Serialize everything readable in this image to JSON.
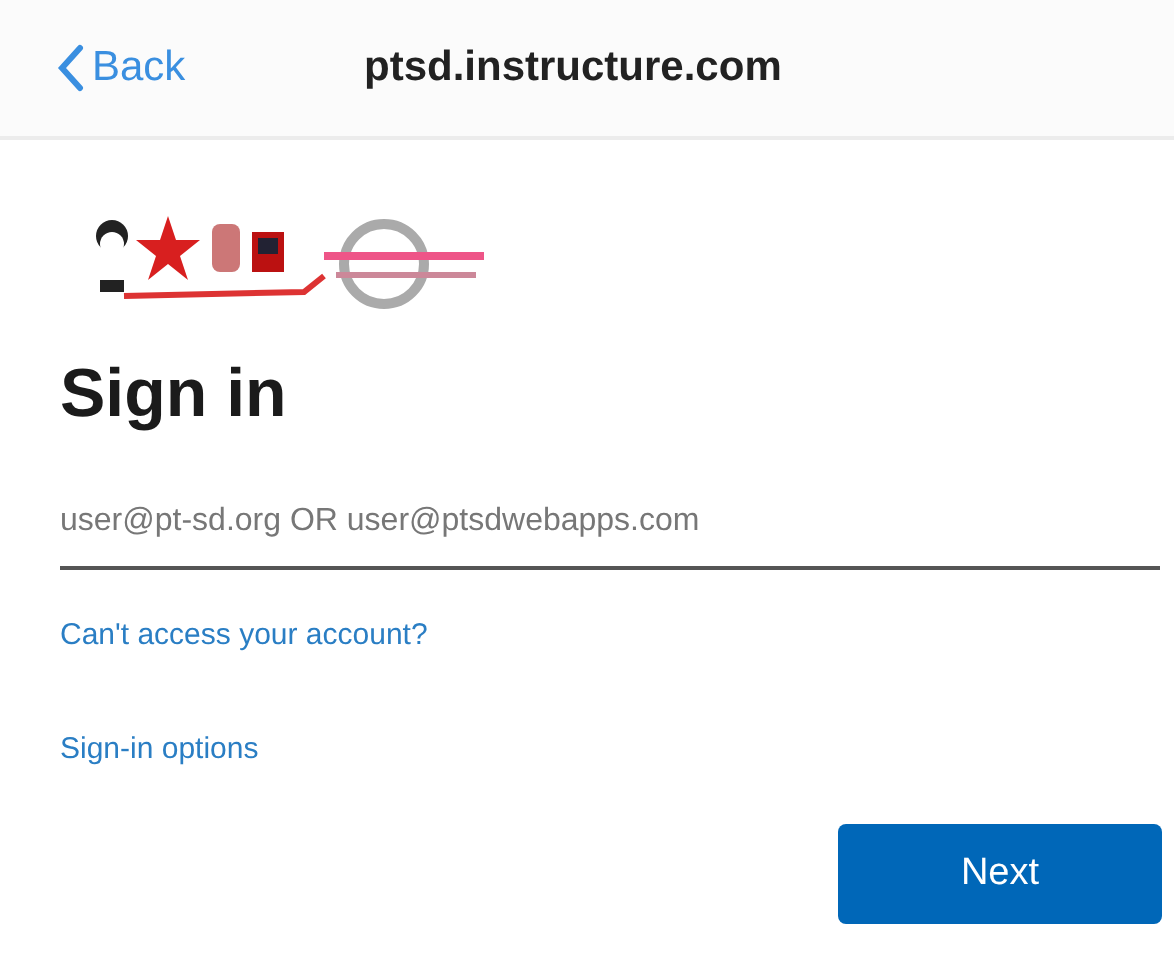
{
  "nav_bar": {
    "back": "Back",
    "title": "ptsd.instructure.com"
  },
  "sign_in": {
    "heading": "Sign in",
    "email_field": {
      "placeholder": "user@pt-sd.org OR user@ptsdwebapps.com"
    },
    "links": [
      "Can't access your account?",
      "Sign-in options"
    ],
    "next_button": "Next"
  }
}
